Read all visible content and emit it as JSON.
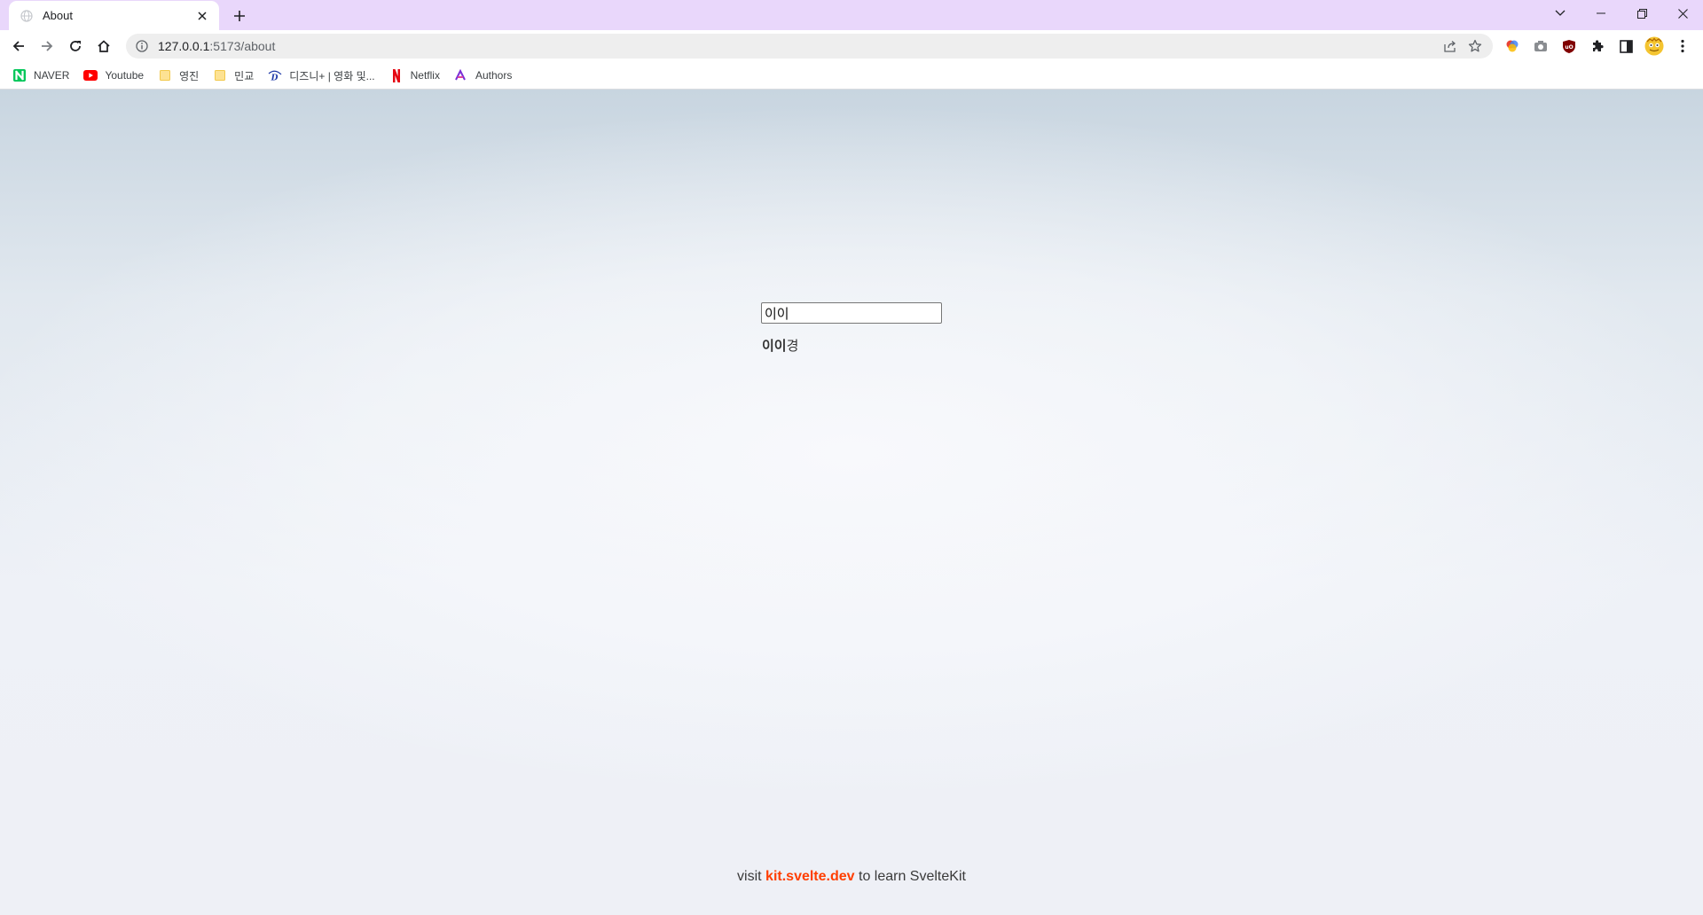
{
  "browser": {
    "tab": {
      "title": "About"
    },
    "address": {
      "host": "127.0.0.1",
      "rest": ":5173/about"
    },
    "bookmarks": [
      {
        "label": "NAVER",
        "icon": "naver-icon"
      },
      {
        "label": "Youtube",
        "icon": "youtube-icon"
      },
      {
        "label": "영진",
        "icon": "folder-icon"
      },
      {
        "label": "민교",
        "icon": "folder-icon"
      },
      {
        "label": "디즈니+ | 영화 및...",
        "icon": "disney-plus-icon"
      },
      {
        "label": "Netflix",
        "icon": "netflix-icon"
      },
      {
        "label": "Authors",
        "icon": "authors-icon"
      }
    ]
  },
  "page": {
    "input_value": "이이",
    "greeting_bold": "이이",
    "greeting_suffix": "경",
    "footer": {
      "prefix": "visit ",
      "link": "kit.svelte.dev",
      "suffix": " to learn SvelteKit"
    }
  },
  "colors": {
    "tabstrip": "#e9d7fb",
    "svelte_orange": "#ff3e00"
  }
}
